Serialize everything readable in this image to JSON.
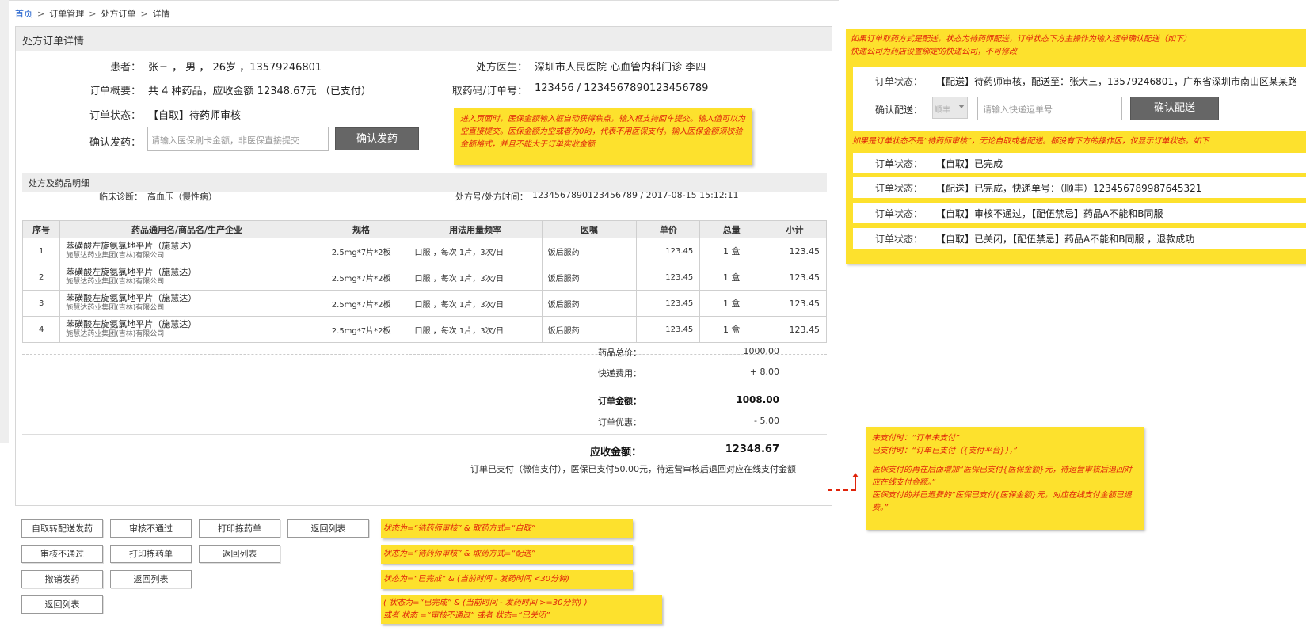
{
  "breadcrumb": {
    "home": "首页",
    "sep": ">",
    "order_mgmt": "订单管理",
    "rx_order": "处方订单",
    "detail": "详情"
  },
  "panel": {
    "title": "处方订单详情",
    "patient_label": "患者：",
    "patient_value": "张三 ， 男 ， 26岁 ，13579246801",
    "doctor_label": "处方医生：",
    "doctor_value": "深圳市人民医院 心血管内科门诊 李四",
    "summary_label": "订单概要：",
    "summary_value": "共 4 种药品，应收金额 12348.67元 （已支付）",
    "pickup_label": "取药码/订单号：",
    "pickup_value": "123456  /  1234567890123456789",
    "status_label": "订单状态：",
    "status_value": "【自取】待药师审核",
    "confirm_label": "确认发药：",
    "confirm_placeholder": "请输入医保刷卡金额，非医保直接提交",
    "confirm_button": "确认发药"
  },
  "section": {
    "title": "处方及药品明细",
    "diagnosis_label": "临床诊断：",
    "diagnosis_value": "高血压（慢性病）",
    "rxno_label": "处方号/处方时间：",
    "rxno_value": "1234567890123456789 / 2017-08-15 15:12:11"
  },
  "table": {
    "headers": [
      "序号",
      "药品通用名/商品名/生产企业",
      "规格",
      "用法用量频率",
      "医嘱",
      "单价",
      "总量",
      "小计"
    ],
    "rows": [
      {
        "no": "1",
        "name": "苯磺酸左旋氨氯地平片（施慧达）",
        "maker": "施慧达药业集团(吉林)有限公司",
        "spec": "2.5mg*7片*2板",
        "usage": "口服 ，每次 1片，3次/日",
        "advice": "饭后服药",
        "price": "123.45",
        "qty": "1 盒",
        "subtotal": "123.45"
      },
      {
        "no": "2",
        "name": "苯磺酸左旋氨氯地平片（施慧达）",
        "maker": "施慧达药业集团(吉林)有限公司",
        "spec": "2.5mg*7片*2板",
        "usage": "口服 ，每次 1片，3次/日",
        "advice": "饭后服药",
        "price": "123.45",
        "qty": "1 盒",
        "subtotal": "123.45"
      },
      {
        "no": "3",
        "name": "苯磺酸左旋氨氯地平片（施慧达）",
        "maker": "施慧达药业集团(吉林)有限公司",
        "spec": "2.5mg*7片*2板",
        "usage": "口服 ，每次 1片，3次/日",
        "advice": "饭后服药",
        "price": "123.45",
        "qty": "1 盒",
        "subtotal": "123.45"
      },
      {
        "no": "4",
        "name": "苯磺酸左旋氨氯地平片（施慧达）",
        "maker": "施慧达药业集团(吉林)有限公司",
        "spec": "2.5mg*7片*2板",
        "usage": "口服 ，每次 1片，3次/日",
        "advice": "饭后服药",
        "price": "123.45",
        "qty": "1 盒",
        "subtotal": "123.45"
      }
    ]
  },
  "totals": {
    "goods_label": "药品总价：",
    "goods_value": "1000.00",
    "ship_label": "快递费用：",
    "ship_value": "+ 8.00",
    "order_label": "订单金额：",
    "order_value": "1008.00",
    "discount_label": "订单优惠：",
    "discount_value": "- 5.00",
    "receivable_label": "应收金额：",
    "receivable_value": "12348.67",
    "paid_note": "订单已支付（微信支付），医保已支付50.00元，待运营审核后退回对应在线支付金额"
  },
  "buttons": {
    "row1": [
      "自取转配送发药",
      "审核不通过",
      "打印拣药单",
      "返回列表"
    ],
    "row2": [
      "审核不通过",
      "打印拣药单",
      "返回列表"
    ],
    "row3": [
      "撤销发药",
      "返回列表"
    ],
    "row4": [
      "返回列表"
    ]
  },
  "notes": {
    "input_note": "进入页面时，医保金额输入框自动获得焦点，输入框支持回车提交。输入值可以为空直接提交。医保金额为空或者为0时，代表不用医保支付。输入医保金额须校验金额格式，并且不能大于订单实收金额",
    "cond1": "状态为=“待药师审核” & 取药方式=“自取”",
    "cond2": "状态为=“待药师审核” & 取药方式=“配送”",
    "cond3": "状态为=“已完成” & (当前时间 - 发药时间 <30分钟)",
    "cond4_line1": "( 状态为=“已完成” & (当前时间 - 发药时间 >=30分钟) )",
    "cond4_line2": "或者 状态 =“审核不通过” 或者 状态=“已关闭”",
    "pay_line1": "未支付时：“订单未支付”",
    "pay_line2": "已支付时：“订单已支付（{支付平台}），”",
    "pay_line3": "医保支付的再在后面增加“医保已支付{医保金额}元，待运营审核后退回对应在线支付金额。”",
    "pay_line4": "医保支付的并已退费的“医保已支付{医保金额}元，对应在线支付金额已退费。”",
    "right_line1": "如果订单取药方式是配送，状态为待药师配送，订单状态下方主操作为输入运单确认配送（如下）",
    "right_line2": "快递公司为药店设置绑定的快递公司，不可修改",
    "right_line3": "如果是订单状态不是“待药师审核”，无论自取或者配送。都没有下方的操作区，仅显示订单状态。如下",
    "deliv_status_label": "订单状态：",
    "deliv_status_value": "【配送】待药师审核，配送至：张大三，13579246801，广东省深圳市南山区某某路",
    "deliv_confirm_label": "确认配送：",
    "deliv_courier": "顺丰",
    "deliv_placeholder": "请输入快递运单号",
    "deliv_button": "确认配送",
    "s1_label": "订单状态：",
    "s1_value": "【自取】已完成",
    "s2_label": "订单状态：",
    "s2_value": "【配送】已完成，快递单号：（顺丰）123456789987645321",
    "s3_label": "订单状态：",
    "s3_value": "【自取】审核不通过，【配伍禁忌】药品A不能和B同服",
    "s4_label": "订单状态：",
    "s4_value": "【自取】已关闭，【配伍禁忌】药品A不能和B同服 ，退款成功"
  },
  "colors": {
    "note_bg": "#fde12d",
    "note_text": "#e0230a",
    "link": "#1a5ccc",
    "dark_button": "#666666"
  }
}
